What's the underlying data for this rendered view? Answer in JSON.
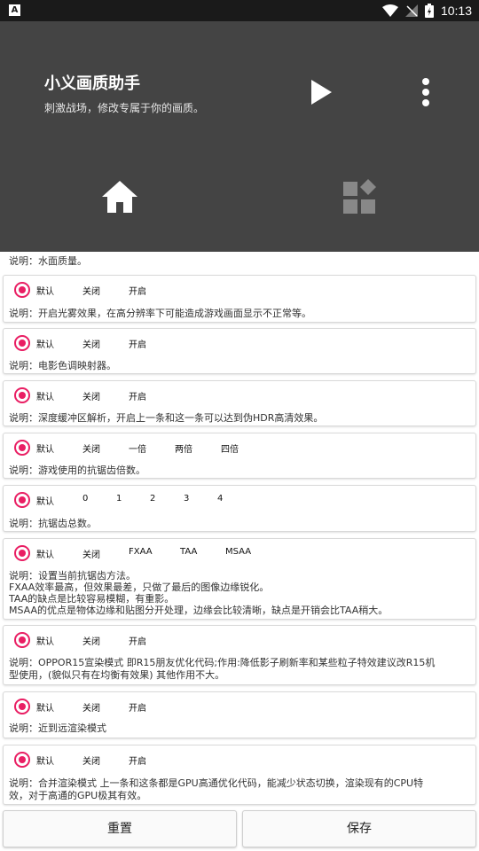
{
  "status_bar": {
    "time": "10:13"
  },
  "header": {
    "title": "小义画质助手",
    "subtitle": "刺激战场，修改专属于你的画质。"
  },
  "top_partial_desc": "说明：水面质量。",
  "cards": [
    {
      "options": [
        "默认",
        "关闭",
        "开启"
      ],
      "desc": [
        "说明：开启光雾效果，在高分辨率下可能造成游戏画面显示不正常等。"
      ]
    },
    {
      "options": [
        "默认",
        "关闭",
        "开启"
      ],
      "desc": [
        "说明：电影色调映射器。"
      ]
    },
    {
      "options": [
        "默认",
        "关闭",
        "开启"
      ],
      "desc": [
        "说明：深度缓冲区解析，开启上一条和这一条可以达到伪HDR高清效果。"
      ]
    },
    {
      "options": [
        "默认",
        "关闭",
        "一倍",
        "两倍",
        "四倍"
      ],
      "desc": [
        "说明：游戏使用的抗锯齿倍数。"
      ]
    },
    {
      "options": [
        "默认",
        "0",
        "1",
        "2",
        "3",
        "4"
      ],
      "desc": [
        "说明：抗锯齿总数。"
      ]
    },
    {
      "options": [
        "默认",
        "关闭",
        "FXAA",
        "TAA",
        "MSAA"
      ],
      "desc": [
        "说明：设置当前抗锯齿方法。",
        "FXAA效率最高，但效果最差，只做了最后的图像边缘锐化。",
        "TAA的缺点是比较容易模糊，有重影。",
        "MSAA的优点是物体边缘和贴图分开处理，边缘会比较清晰，缺点是开销会比TAA稍大。"
      ]
    },
    {
      "options": [
        "默认",
        "关闭",
        "开启"
      ],
      "desc": [
        "说明：OPPOR15宣染模式 即R15朋友优化代码;作用:降低影子刷新率和某些粒子特效建议改R15机",
        "型使用，(貌似只有在均衡有效果) 其他作用不大。"
      ]
    },
    {
      "options": [
        "默认",
        "关闭",
        "开启"
      ],
      "desc": [
        "说明：近到远渲染模式"
      ]
    },
    {
      "options": [
        "默认",
        "关闭",
        "开启"
      ],
      "desc": [
        "说明：合并渲染模式 上一条和这条都是GPU高通优化代码，能减少状态切换，渲染现有的CPU特",
        "效，对于高通的GPU极其有效。"
      ]
    }
  ],
  "buttons": {
    "reset": "重置",
    "save": "保存"
  },
  "colors": {
    "header_bg": "#444444",
    "accent": "#e91e63"
  },
  "icons": [
    "play-icon",
    "more-vert-icon",
    "home-icon",
    "apps-icon"
  ]
}
